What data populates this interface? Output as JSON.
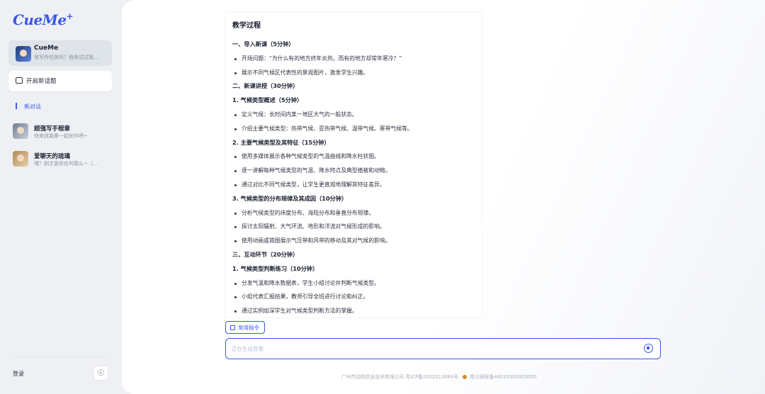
{
  "app": {
    "logo": "CueMe",
    "logo_plus": "+"
  },
  "sidebar": {
    "bot": {
      "name": "CueMe",
      "subtitle": "有写作任务吗？快来试试我..."
    },
    "new_topic_label": "开启新话题",
    "section_label": "新对话",
    "conversations": [
      {
        "title": "超强写手程章",
        "subtitle": "快来找我拿一起创作吧~"
      },
      {
        "title": "爱聊天的琉璃",
        "subtitle": "嘿？刚才是你在叫我么~（..."
      }
    ],
    "login_label": "登录",
    "info_icon": "ⓘ"
  },
  "document": {
    "title": "教学过程",
    "lines": [
      {
        "type": "h",
        "text": "一、导入新课（5分钟）"
      },
      {
        "type": "b",
        "text": "开场问题：“为什么有的地方终年炎热，而有的地方却常年寒冷？”"
      },
      {
        "type": "b",
        "text": "展示不同气候区代表性的景观图片，激发学生兴趣。"
      },
      {
        "type": "h",
        "text": "二、新课讲授（30分钟）"
      },
      {
        "type": "h",
        "text": "1. 气候类型概述（5分钟）"
      },
      {
        "type": "b",
        "text": "定义气候：长时间内某一地区大气的一般状态。"
      },
      {
        "type": "b",
        "text": "介绍主要气候类型：热带气候、亚热带气候、温带气候、寒带气候等。"
      },
      {
        "type": "h",
        "text": "2. 主要气候类型及其特征（15分钟）"
      },
      {
        "type": "b",
        "text": "使用多媒体展示各种气候类型的气温曲线和降水柱状图。"
      },
      {
        "type": "b",
        "text": "逐一讲解每种气候类型的气温、降水特点及典型植被和动物。"
      },
      {
        "type": "b",
        "text": "通过对比不同气候类型，让学生更直观地理解其特征差异。"
      },
      {
        "type": "h",
        "text": "3. 气候类型的分布规律及其成因（10分钟）"
      },
      {
        "type": "b",
        "text": "分析气候类型的纬度分布、海陆分布和垂直分布规律。"
      },
      {
        "type": "b",
        "text": "探讨太阳辐射、大气环流、地形和洋流对气候形成的影响。"
      },
      {
        "type": "b",
        "text": "使用动画或简图展示气压带和风带的移动及其对气候的影响。"
      },
      {
        "type": "h",
        "text": "三、互动环节（20分钟）"
      },
      {
        "type": "h",
        "text": "1. 气候类型判断练习（10分钟）"
      },
      {
        "type": "b",
        "text": "分发气温和降水数据表，学生小组讨论并判断气候类型。"
      },
      {
        "type": "b",
        "text": "小组代表汇报结果，教师引导全班进行讨论和纠正。"
      },
      {
        "type": "b",
        "text": "通过实例加深学生对气候类型判断方法的掌握。"
      }
    ]
  },
  "composer": {
    "command_button_label": "常用指令",
    "input_placeholder": "正在生成答案"
  },
  "footer": {
    "company": "广州市动悦信息技术有限公司 粤ICP备2022013084号",
    "police": "粤公网安备44010502003055"
  },
  "colors": {
    "accent": "#3a57e8"
  }
}
